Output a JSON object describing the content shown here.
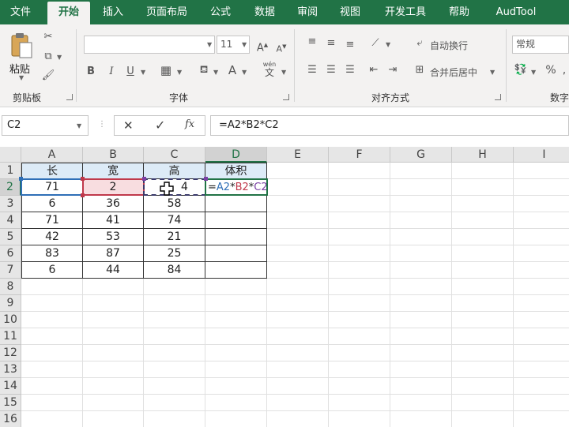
{
  "tabs": [
    "文件",
    "开始",
    "插入",
    "页面布局",
    "公式",
    "数据",
    "审阅",
    "视图",
    "开发工具",
    "帮助",
    "AudTool"
  ],
  "ribbon": {
    "paste_label": "粘贴",
    "clipboard_label": "剪贴板",
    "font_label": "字体",
    "font_size": "11",
    "bold": "B",
    "italic": "I",
    "underline": "U",
    "wrap_text": "自动换行",
    "merge_center": "合并后居中",
    "alignment_label": "对齐方式",
    "number_format": "常规",
    "number_label": "数字",
    "percent": "%",
    "wen_top": "wén",
    "wen_bottom": "文"
  },
  "formula_bar": {
    "name_box": "C2",
    "cancel": "✕",
    "enter": "✓",
    "fx": "fx",
    "formula": "=A2*B2*C2"
  },
  "sheet": {
    "columns": [
      "A",
      "B",
      "C",
      "D",
      "E",
      "F",
      "G",
      "H",
      "I"
    ],
    "rows": [
      "1",
      "2",
      "3",
      "4",
      "5",
      "6",
      "7",
      "8",
      "9",
      "10",
      "11",
      "12",
      "13",
      "14",
      "15",
      "16"
    ],
    "headers": [
      "长",
      "宽",
      "高",
      "体积"
    ],
    "data": [
      [
        "71",
        "2",
        "4"
      ],
      [
        "6",
        "36",
        "58"
      ],
      [
        "71",
        "41",
        "74"
      ],
      [
        "42",
        "53",
        "21"
      ],
      [
        "83",
        "87",
        "25"
      ],
      [
        "6",
        "44",
        "84"
      ]
    ],
    "edit_formula": {
      "eq": "=",
      "a": "A2",
      "m1": "*",
      "b": "B2",
      "m2": "*",
      "c": "C2"
    }
  },
  "colors": {
    "brand": "#217346",
    "ref_a": "#2f6fb7",
    "ref_b": "#c0394b",
    "ref_c": "#7a3fa4"
  }
}
